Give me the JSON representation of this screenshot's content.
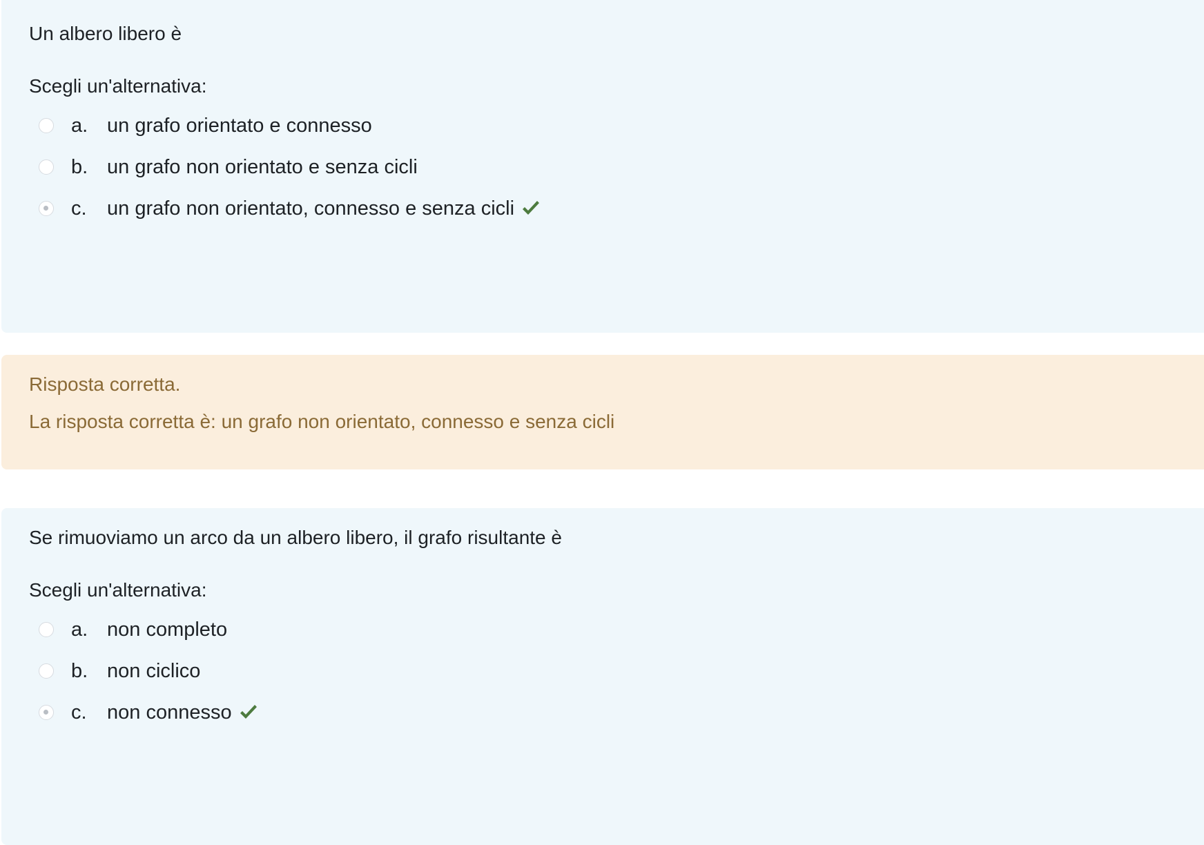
{
  "questions": [
    {
      "text": "Un albero libero è",
      "prompt": "Scegli un'alternativa:",
      "answers": [
        {
          "letter": "a.",
          "text": "un grafo orientato e connesso",
          "selected": false,
          "correct_mark": false
        },
        {
          "letter": "b.",
          "text": "un grafo non orientato e senza cicli",
          "selected": false,
          "correct_mark": false
        },
        {
          "letter": "c.",
          "text": "un grafo non orientato, connesso e senza cicli",
          "selected": true,
          "correct_mark": true
        }
      ]
    },
    {
      "text": "Se rimuoviamo un arco da un albero libero, il grafo risultante è",
      "prompt": "Scegli un'alternativa:",
      "answers": [
        {
          "letter": "a.",
          "text": "non completo",
          "selected": false,
          "correct_mark": false
        },
        {
          "letter": "b.",
          "text": "non ciclico",
          "selected": false,
          "correct_mark": false
        },
        {
          "letter": "c.",
          "text": "non connesso",
          "selected": true,
          "correct_mark": true
        }
      ]
    }
  ],
  "feedback": {
    "status": "Risposta corretta.",
    "right_answer": "La risposta corretta è: un grafo non orientato, connesso e senza cicli"
  },
  "colors": {
    "question_bg": "#eff7fb",
    "feedback_bg": "#fbeedd",
    "feedback_text": "#8a6a36",
    "check_green": "#4d7b3f"
  }
}
